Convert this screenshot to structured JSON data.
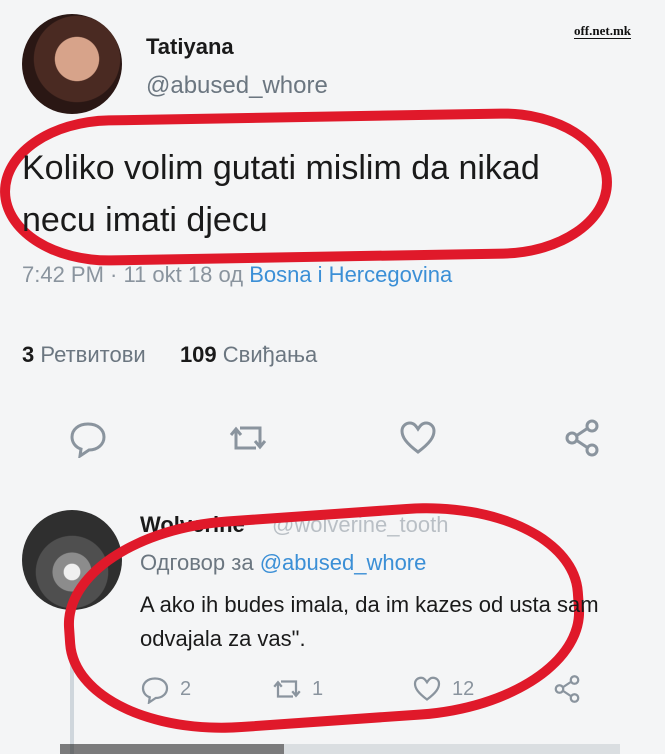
{
  "watermark": "off.net.mk",
  "tweet": {
    "author_name": "Tatiyana",
    "author_handle": "@abused_whore",
    "text": "Koliko volim gutati mislim da nikad necu imati djecu",
    "timestamp": "7:42 PM · 11 okt 18 од ",
    "location": "Bosna i Hercegovina",
    "retweets_count": "3",
    "retweets_label": "Ретвитови",
    "likes_count": "109",
    "likes_label": "Свиђања"
  },
  "reply": {
    "author_name": "Wolverine",
    "author_handle": "@wolverine_tooth",
    "reply_to_label": "Одговор за ",
    "reply_to_handle": "@abused_whore",
    "text": "A ako ih budes imala, da im kazes od usta sam odvajala za vas\".",
    "reply_count": "2",
    "retweet_count": "1",
    "like_count": "12"
  },
  "icons": [
    "comment-icon",
    "retweet-icon",
    "heart-icon",
    "share-icon"
  ],
  "colors": {
    "accent": "#3b8fd6",
    "highlight_ring": "#e0192a",
    "muted": "#8a949e"
  }
}
